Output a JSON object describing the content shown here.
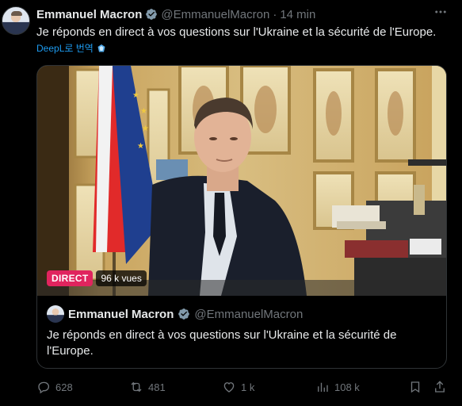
{
  "tweet": {
    "author_name": "Emmanuel Macron",
    "handle": "@EmmanuelMacron",
    "separator": "·",
    "time": "14 min",
    "text": "Je réponds en direct à vos questions sur l'Ukraine et la sécurité de l'Europe.",
    "translate_label": "DeepL로 번역",
    "more_icon": "more-icon"
  },
  "video": {
    "live_badge": "DIRECT",
    "views": "96 k vues"
  },
  "quoted": {
    "author_name": "Emmanuel Macron",
    "handle": "@EmmanuelMacron",
    "text": "Je réponds en direct à vos questions sur l'Ukraine et la sécurité de l'Europe."
  },
  "actions": {
    "replies": "628",
    "reposts": "481",
    "likes": "1 k",
    "views": "108 k"
  },
  "colors": {
    "background": "#000000",
    "text_primary": "#e7e9ea",
    "text_secondary": "#71767b",
    "accent": "#1d9bf0",
    "live_badge": "#e0245e"
  }
}
